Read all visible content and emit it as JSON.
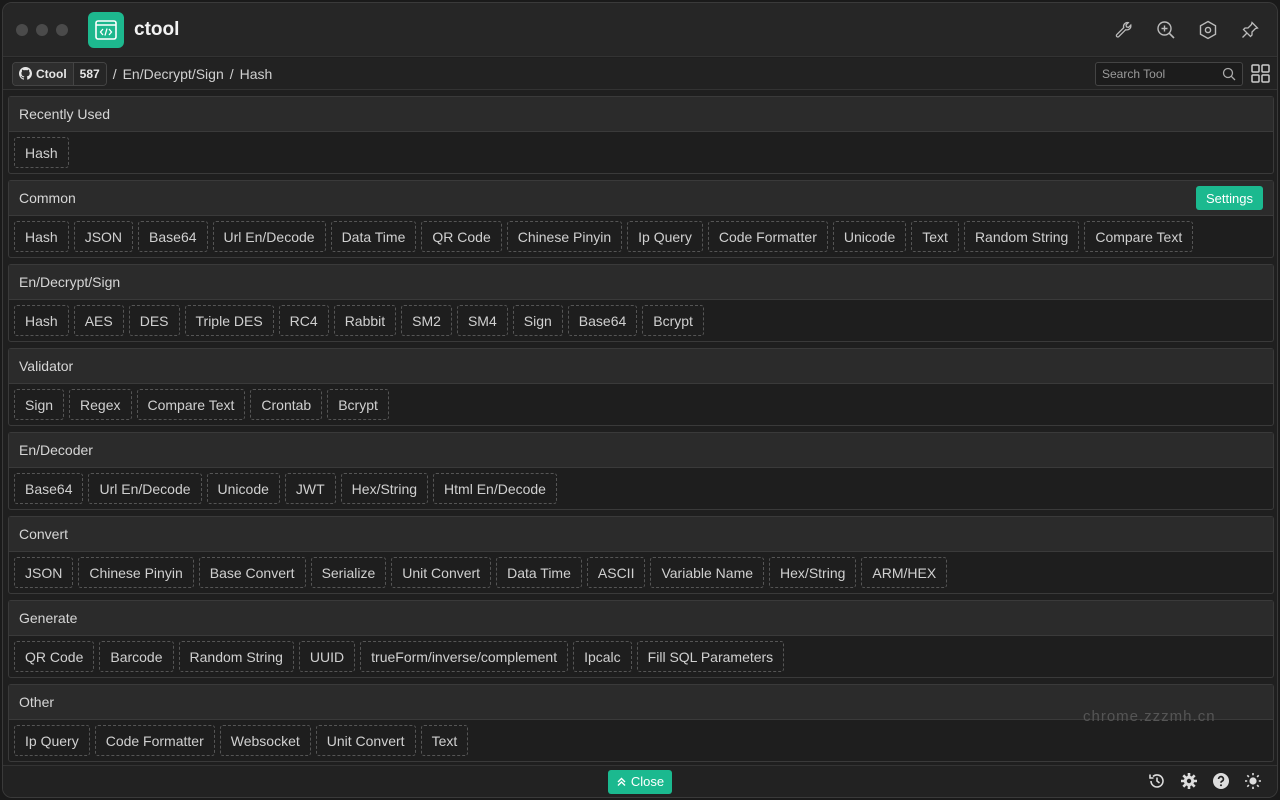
{
  "app": {
    "title": "ctool"
  },
  "nav": {
    "github_label": "Ctool",
    "github_count": "587",
    "breadcrumb": [
      "En/Decrypt/Sign",
      "Hash"
    ],
    "search_placeholder": "Search Tool"
  },
  "sections": [
    {
      "title": "Recently Used",
      "items": [
        "Hash"
      ]
    },
    {
      "title": "Common",
      "settings": "Settings",
      "items": [
        "Hash",
        "JSON",
        "Base64",
        "Url En/Decode",
        "Data Time",
        "QR Code",
        "Chinese Pinyin",
        "Ip Query",
        "Code Formatter",
        "Unicode",
        "Text",
        "Random String",
        "Compare Text"
      ]
    },
    {
      "title": "En/Decrypt/Sign",
      "items": [
        "Hash",
        "AES",
        "DES",
        "Triple DES",
        "RC4",
        "Rabbit",
        "SM2",
        "SM4",
        "Sign",
        "Base64",
        "Bcrypt"
      ]
    },
    {
      "title": "Validator",
      "items": [
        "Sign",
        "Regex",
        "Compare Text",
        "Crontab",
        "Bcrypt"
      ]
    },
    {
      "title": "En/Decoder",
      "items": [
        "Base64",
        "Url En/Decode",
        "Unicode",
        "JWT",
        "Hex/String",
        "Html En/Decode"
      ]
    },
    {
      "title": "Convert",
      "items": [
        "JSON",
        "Chinese Pinyin",
        "Base Convert",
        "Serialize",
        "Unit Convert",
        "Data Time",
        "ASCII",
        "Variable Name",
        "Hex/String",
        "ARM/HEX"
      ]
    },
    {
      "title": "Generate",
      "items": [
        "QR Code",
        "Barcode",
        "Random String",
        "UUID",
        "trueForm/inverse/complement",
        "Ipcalc",
        "Fill SQL Parameters"
      ]
    },
    {
      "title": "Other",
      "items": [
        "Ip Query",
        "Code Formatter",
        "Websocket",
        "Unit Convert",
        "Text"
      ]
    }
  ],
  "footer": {
    "close_label": "Close"
  },
  "watermark": "chrome.zzzmh.cn",
  "colors": {
    "accent": "#1bb98f",
    "background": "#1f1f1f",
    "header": "#2b2b2b"
  },
  "icons": {
    "title_actions": [
      "wrench-icon",
      "zoom-in-icon",
      "hexagon-settings-icon",
      "pin-icon"
    ],
    "footer_actions": [
      "history-icon",
      "gear-icon",
      "help-icon",
      "theme-sun-icon"
    ]
  }
}
